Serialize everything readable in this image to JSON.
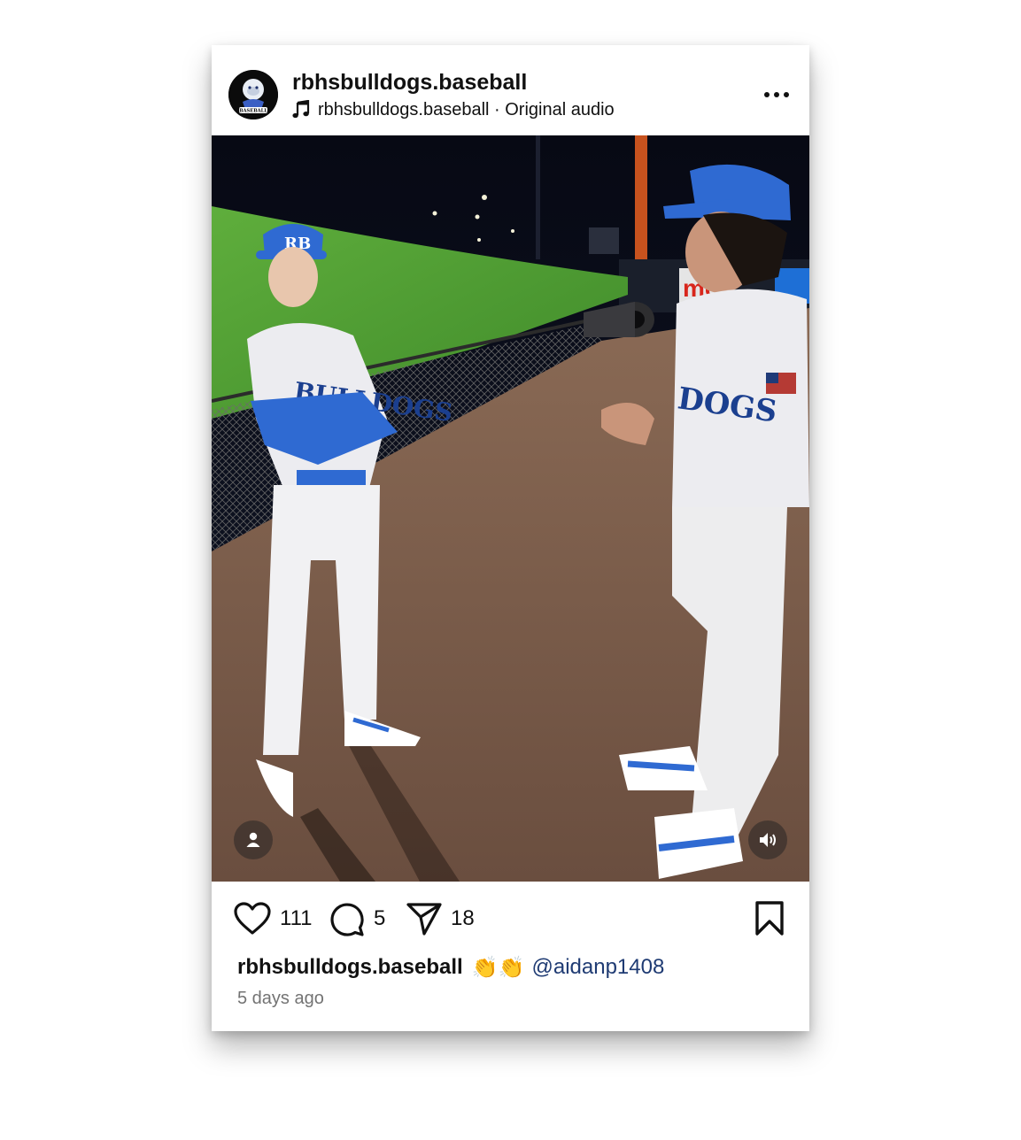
{
  "post": {
    "username": "rbhsbulldogs.baseball",
    "avatar_label": "BASEBALL",
    "audio_owner": "rbhsbulldogs.baseball",
    "audio_separator": " · ",
    "audio_title": "Original audio",
    "more_icon": "more-horizontal-icon",
    "media": {
      "type": "video",
      "cap_letters": "RB",
      "jersey_left": "BULLDOGS",
      "jersey_right": "DOGS",
      "banner_text": "me",
      "tag_icon": "user-tag-icon",
      "sound_icon": "speaker-volume-icon"
    },
    "stats": {
      "likes": "111",
      "comments": "5",
      "shares": "18"
    },
    "icons": {
      "like": "heart-icon",
      "comment": "comment-bubble-icon",
      "share": "paper-plane-icon",
      "save": "bookmark-icon"
    },
    "caption": {
      "user": "rbhsbulldogs.baseball",
      "emoji": "👏👏",
      "mention": "@aidanp1408"
    },
    "timestamp": "5 days ago"
  }
}
